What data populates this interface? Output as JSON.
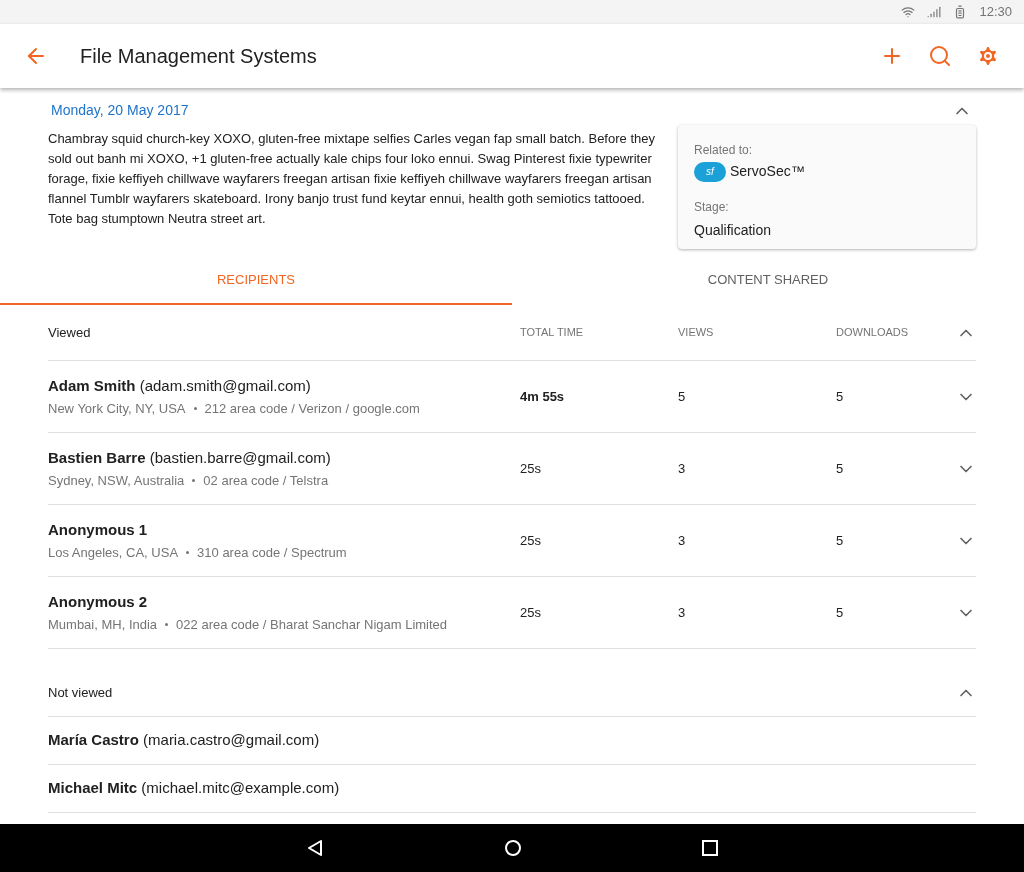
{
  "status_bar": {
    "time": "12:30"
  },
  "app_bar": {
    "title": "File Management Systems"
  },
  "summary": {
    "date": "Monday, 20 May 2017",
    "expanded": true,
    "description": "Chambray squid church-key XOXO, gluten-free mixtape selfies Carles vegan fap small batch. Before they sold out banh mi XOXO, +1 gluten-free actually kale chips four loko ennui. Swag Pinterest fixie typewriter forage, fixie keffiyeh chillwave wayfarers freegan artisan fixie keffiyeh chillwave wayfarers freegan artisan flannel Tumblr wayfarers skateboard. Irony banjo trust fund keytar ennui, health goth semiotics tattooed. Tote bag stumptown Neutra street art.",
    "card": {
      "related_label": "Related to:",
      "logo_text": "sf",
      "related_value": "ServoSec™",
      "stage_label": "Stage:",
      "stage_value": "Qualification"
    }
  },
  "tabs": [
    {
      "label": "RECIPIENTS",
      "selected": true
    },
    {
      "label": "CONTENT SHARED",
      "selected": false
    }
  ],
  "viewed": {
    "title": "Viewed",
    "expanded": true,
    "columns": [
      "TOTAL TIME",
      "VIEWS",
      "DOWNLOADS"
    ],
    "rows": [
      {
        "name": "**Adam Smith** (adam.smith@gmail.com)",
        "location": "New York City, NY, USA",
        "details": "212 area code / Verizon / google.com",
        "total_time": "4m 55s",
        "views": "5",
        "downloads": "5",
        "expanded": false
      },
      {
        "name": "**Bastien Barre** (bastien.barre@gmail.com)",
        "location": "Sydney, NSW, Australia",
        "details": "02 area code / Telstra",
        "total_time": "25s",
        "views": "3",
        "downloads": "5",
        "expanded": false
      },
      {
        "name": "**Anonymous 1**",
        "location": "Los Angeles, CA, USA",
        "details": "310 area code / Spectrum",
        "total_time": "25s",
        "views": "3",
        "downloads": "5",
        "expanded": false
      },
      {
        "name": "**Anonymous 2**",
        "location": "Mumbai, MH, India",
        "details": "022 area code / Bharat Sanchar Nigam Limited",
        "total_time": "25s",
        "views": "3",
        "downloads": "5",
        "expanded": false
      }
    ]
  },
  "not_viewed": {
    "title": "Not viewed",
    "expanded": true,
    "rows": [
      {
        "name": "**María Castro** (maria.castro@gmail.com)"
      },
      {
        "name": "**Michael Mitc** (michael.mitc@example.com)"
      }
    ]
  }
}
